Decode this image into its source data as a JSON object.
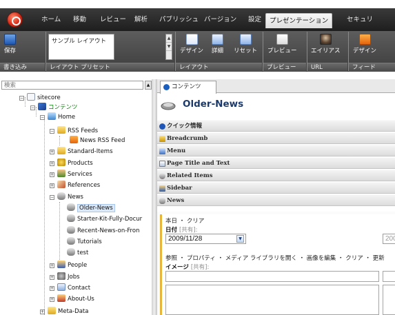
{
  "menu": {
    "tabs": [
      "ホーム",
      "移動",
      "レビュー",
      "解析",
      "パブリッシュ",
      "バージョン",
      "設定",
      "プレゼンテーション",
      "セキュリ"
    ],
    "active_tab": "プレゼンテーション"
  },
  "ribbon": {
    "save_label": "保存",
    "preset_value": "サンプル レイアウト",
    "design_label": "デザイン",
    "details_label": "詳細",
    "reset_label": "リセット",
    "preview_label": "プレビュー",
    "alias_label": "エイリアス",
    "feed_design_label": "デザイン",
    "group_labels": [
      "書き込み",
      "レイアウト プリセット",
      "レイアウト",
      "プレビュー",
      "URL",
      "フィード"
    ]
  },
  "search": {
    "placeholder": "検索"
  },
  "tree": [
    {
      "label": "sitecore",
      "icon": "page-icon",
      "expander": "⊟"
    },
    {
      "label": "コンテンツ",
      "icon": "content-icon",
      "expander": "⊟"
    },
    {
      "label": "Home",
      "icon": "home-icon",
      "expander": "⊟"
    },
    {
      "label": "RSS Feeds",
      "icon": "folder-icon",
      "expander": "⊟"
    },
    {
      "label": "News RSS Feed",
      "icon": "rss-icon",
      "expander": ""
    },
    {
      "label": "Standard-Items",
      "icon": "folder-icon",
      "expander": "⊞"
    },
    {
      "label": "Products",
      "icon": "products-icon",
      "expander": "⊞"
    },
    {
      "label": "Services",
      "icon": "services-icon",
      "expander": "⊞"
    },
    {
      "label": "References",
      "icon": "references-icon",
      "expander": "⊞"
    },
    {
      "label": "News",
      "icon": "news-icon",
      "expander": "⊟"
    },
    {
      "label": "Older-News",
      "icon": "news-icon",
      "expander": ""
    },
    {
      "label": "Starter-Kit-Fully-Docur",
      "icon": "news-icon",
      "expander": ""
    },
    {
      "label": "Recent-News-on-Fron",
      "icon": "news-icon",
      "expander": ""
    },
    {
      "label": "Tutorials",
      "icon": "news-icon",
      "expander": ""
    },
    {
      "label": "test",
      "icon": "news-icon",
      "expander": ""
    },
    {
      "label": "People",
      "icon": "people-icon",
      "expander": "⊞"
    },
    {
      "label": "Jobs",
      "icon": "jobs-icon",
      "expander": "⊞"
    },
    {
      "label": "Contact",
      "icon": "contact-icon",
      "expander": "⊞"
    },
    {
      "label": "About-Us",
      "icon": "about-icon",
      "expander": "⊞"
    },
    {
      "label": "Meta-Data",
      "icon": "folder-icon",
      "expander": "⊞"
    }
  ],
  "editor": {
    "tab_label": "コンテンツ",
    "item_title": "Older-News",
    "sections": [
      "クイック情報",
      "Breadcrumb",
      "Menu",
      "Page Title and Text",
      "Related Items",
      "Sidebar",
      "News"
    ],
    "date_actions": "本日 ・ クリア",
    "date_label": "日付",
    "shared_tag": "[共有]:",
    "date_value": "2009/11/28",
    "date_value_2": "200",
    "image_actions": "参照 ・ プロパティ ・ メディア ライブラリを開く ・ 画像を編集 ・ クリア ・ 更新",
    "image_label": "イメージ",
    "date_shared": "[共有]:",
    "image_shared": "[共有]:"
  },
  "colors": {
    "accent": "#1b3a6b",
    "ribbon": "#4a4a4a",
    "news_bar": "#e6b53a"
  }
}
